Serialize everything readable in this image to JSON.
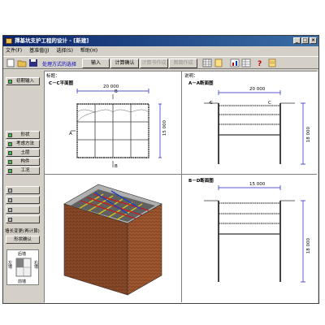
{
  "window": {
    "title": "擇基坑支护工程的设计 - [新建]"
  },
  "menu": [
    "文件(F)",
    "基准值(J)",
    "选择(S)",
    "帮助(H)"
  ],
  "toolbar": {
    "selection_label": "处理方式的选择",
    "tabs": [
      {
        "label": "输入",
        "enabled": true
      },
      {
        "label": "计算确认",
        "enabled": true
      },
      {
        "label": "计算书作成",
        "enabled": false
      },
      {
        "label": "图面作成",
        "enabled": false
      }
    ]
  },
  "left_panel": {
    "initial_input": "初期输入",
    "inputs": [
      "形状",
      "考虑方法",
      "土层",
      "构件",
      "工况"
    ],
    "disabled": [
      "",
      "",
      "",
      ""
    ],
    "wall_change_label": "墙长变更(再计算)",
    "shape_confirm": "形状确认",
    "walls": {
      "rear": "后墙",
      "left": "左墙",
      "right": "右墙",
      "front": "前墙"
    }
  },
  "main": {
    "overview_label": "标题：",
    "plan_title": "C－C平面图",
    "desc_label": "说明：",
    "section_aa_title": "A－A断面图",
    "section_bb_title": "B－D断面图",
    "plan_width": "20 000",
    "plan_height": "15 000",
    "aa_width": "20 000",
    "aa_depth": "18 000",
    "bb_width": "15 000",
    "bb_depth": "18 000",
    "marks": {
      "a": "A",
      "b": "B",
      "c": "C"
    }
  }
}
